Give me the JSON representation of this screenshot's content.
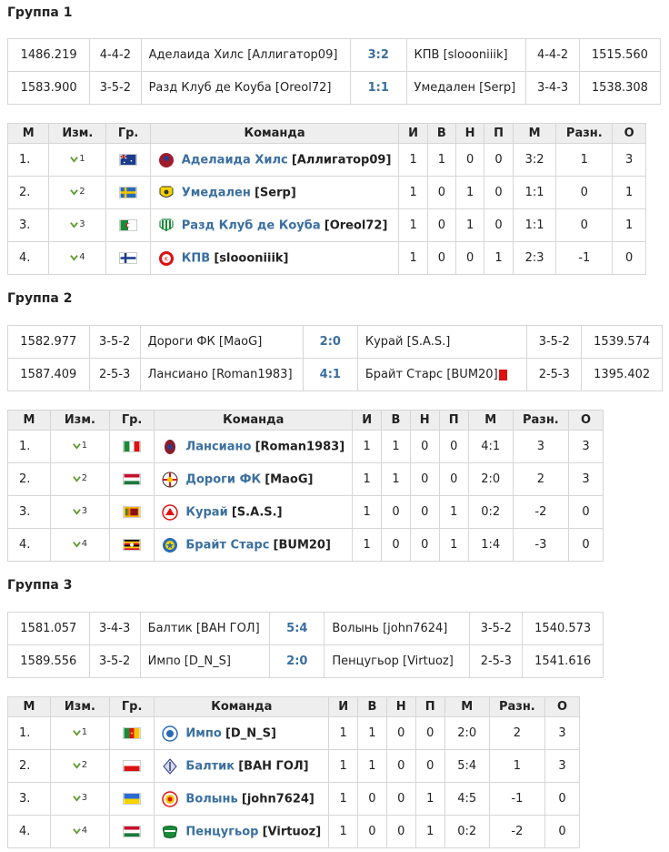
{
  "groups": [
    {
      "title": "Группа 1",
      "matches": [
        {
          "r1": "1486.219",
          "f1": "4-4-2",
          "t1": "Аделаида Хилс [Аллигатор09]",
          "score": "3:2",
          "t2": "КПВ [sloooniiik]",
          "f2": "4-4-2",
          "r2": "1515.560"
        },
        {
          "r1": "1583.900",
          "f1": "3-5-2",
          "t1": "Разд Клуб де Коуба [Oreol72]",
          "score": "1:1",
          "t2": "Умедален [Serp]",
          "f2": "3-4-3",
          "r2": "1538.308"
        }
      ],
      "headers": [
        "М",
        "Изм.",
        "Гр.",
        "Команда",
        "И",
        "В",
        "Н",
        "П",
        "М",
        "Разн.",
        "О"
      ],
      "rows": [
        {
          "pos": "1.",
          "chg": "1",
          "team": "Аделаида Хилс",
          "user": "[Аллигатор09]",
          "p": "1",
          "w": "1",
          "d": "0",
          "l": "0",
          "g": "3:2",
          "diff": "1",
          "pts": "3"
        },
        {
          "pos": "2.",
          "chg": "2",
          "team": "Умедален",
          "user": "[Serp]",
          "p": "1",
          "w": "0",
          "d": "1",
          "l": "0",
          "g": "1:1",
          "diff": "0",
          "pts": "1"
        },
        {
          "pos": "3.",
          "chg": "3",
          "team": "Разд Клуб де Коуба",
          "user": "[Oreol72]",
          "p": "1",
          "w": "0",
          "d": "1",
          "l": "0",
          "g": "1:1",
          "diff": "0",
          "pts": "1"
        },
        {
          "pos": "4.",
          "chg": "4",
          "team": "КПВ",
          "user": "[sloooniiik]",
          "p": "1",
          "w": "0",
          "d": "0",
          "l": "1",
          "g": "2:3",
          "diff": "-1",
          "pts": "0"
        }
      ]
    },
    {
      "title": "Группа 2",
      "matches": [
        {
          "r1": "1582.977",
          "f1": "3-5-2",
          "t1": "Дороги ФК [MaoG]",
          "score": "2:0",
          "t2": "Курай [S.A.S.]",
          "f2": "3-5-2",
          "r2": "1539.574"
        },
        {
          "r1": "1587.409",
          "f1": "2-5-3",
          "t1": "Лансиано [Roman1983]",
          "score": "4:1",
          "t2": "Брайт Старс [BUM20]",
          "f2": "2-5-3",
          "r2": "1395.402"
        }
      ],
      "headers": [
        "М",
        "Изм.",
        "Гр.",
        "Команда",
        "И",
        "В",
        "Н",
        "П",
        "М",
        "Разн.",
        "О"
      ],
      "rows": [
        {
          "pos": "1.",
          "chg": "1",
          "team": "Лансиано",
          "user": "[Roman1983]",
          "p": "1",
          "w": "1",
          "d": "0",
          "l": "0",
          "g": "4:1",
          "diff": "3",
          "pts": "3"
        },
        {
          "pos": "2.",
          "chg": "2",
          "team": "Дороги ФК",
          "user": "[MaoG]",
          "p": "1",
          "w": "1",
          "d": "0",
          "l": "0",
          "g": "2:0",
          "diff": "2",
          "pts": "3"
        },
        {
          "pos": "3.",
          "chg": "3",
          "team": "Курай",
          "user": "[S.A.S.]",
          "p": "1",
          "w": "0",
          "d": "0",
          "l": "1",
          "g": "0:2",
          "diff": "-2",
          "pts": "0"
        },
        {
          "pos": "4.",
          "chg": "4",
          "team": "Брайт Старс",
          "user": "[BUM20]",
          "p": "1",
          "w": "0",
          "d": "0",
          "l": "1",
          "g": "1:4",
          "diff": "-3",
          "pts": "0"
        }
      ]
    },
    {
      "title": "Группа 3",
      "matches": [
        {
          "r1": "1581.057",
          "f1": "3-4-3",
          "t1": "Балтик [ВАН ГОЛ]",
          "score": "5:4",
          "t2": "Волынь [john7624]",
          "f2": "3-5-2",
          "r2": "1540.573"
        },
        {
          "r1": "1589.556",
          "f1": "3-5-2",
          "t1": "Импо [D_N_S]",
          "score": "2:0",
          "t2": "Пенцугьор [Virtuoz]",
          "f2": "2-5-3",
          "r2": "1541.616"
        }
      ],
      "headers": [
        "М",
        "Изм.",
        "Гр.",
        "Команда",
        "И",
        "В",
        "Н",
        "П",
        "М",
        "Разн.",
        "О"
      ],
      "rows": [
        {
          "pos": "1.",
          "chg": "1",
          "team": "Импо",
          "user": "[D_N_S]",
          "p": "1",
          "w": "1",
          "d": "0",
          "l": "0",
          "g": "2:0",
          "diff": "2",
          "pts": "3"
        },
        {
          "pos": "2.",
          "chg": "2",
          "team": "Балтик",
          "user": "[ВАН ГОЛ]",
          "p": "1",
          "w": "1",
          "d": "0",
          "l": "0",
          "g": "5:4",
          "diff": "1",
          "pts": "3"
        },
        {
          "pos": "3.",
          "chg": "3",
          "team": "Волынь",
          "user": "[john7624]",
          "p": "1",
          "w": "0",
          "d": "0",
          "l": "1",
          "g": "4:5",
          "diff": "-1",
          "pts": "0"
        },
        {
          "pos": "4.",
          "chg": "4",
          "team": "Пенцугьор",
          "user": "[Virtuoz]",
          "p": "1",
          "w": "0",
          "d": "0",
          "l": "1",
          "g": "0:2",
          "diff": "-2",
          "pts": "0"
        }
      ]
    }
  ]
}
